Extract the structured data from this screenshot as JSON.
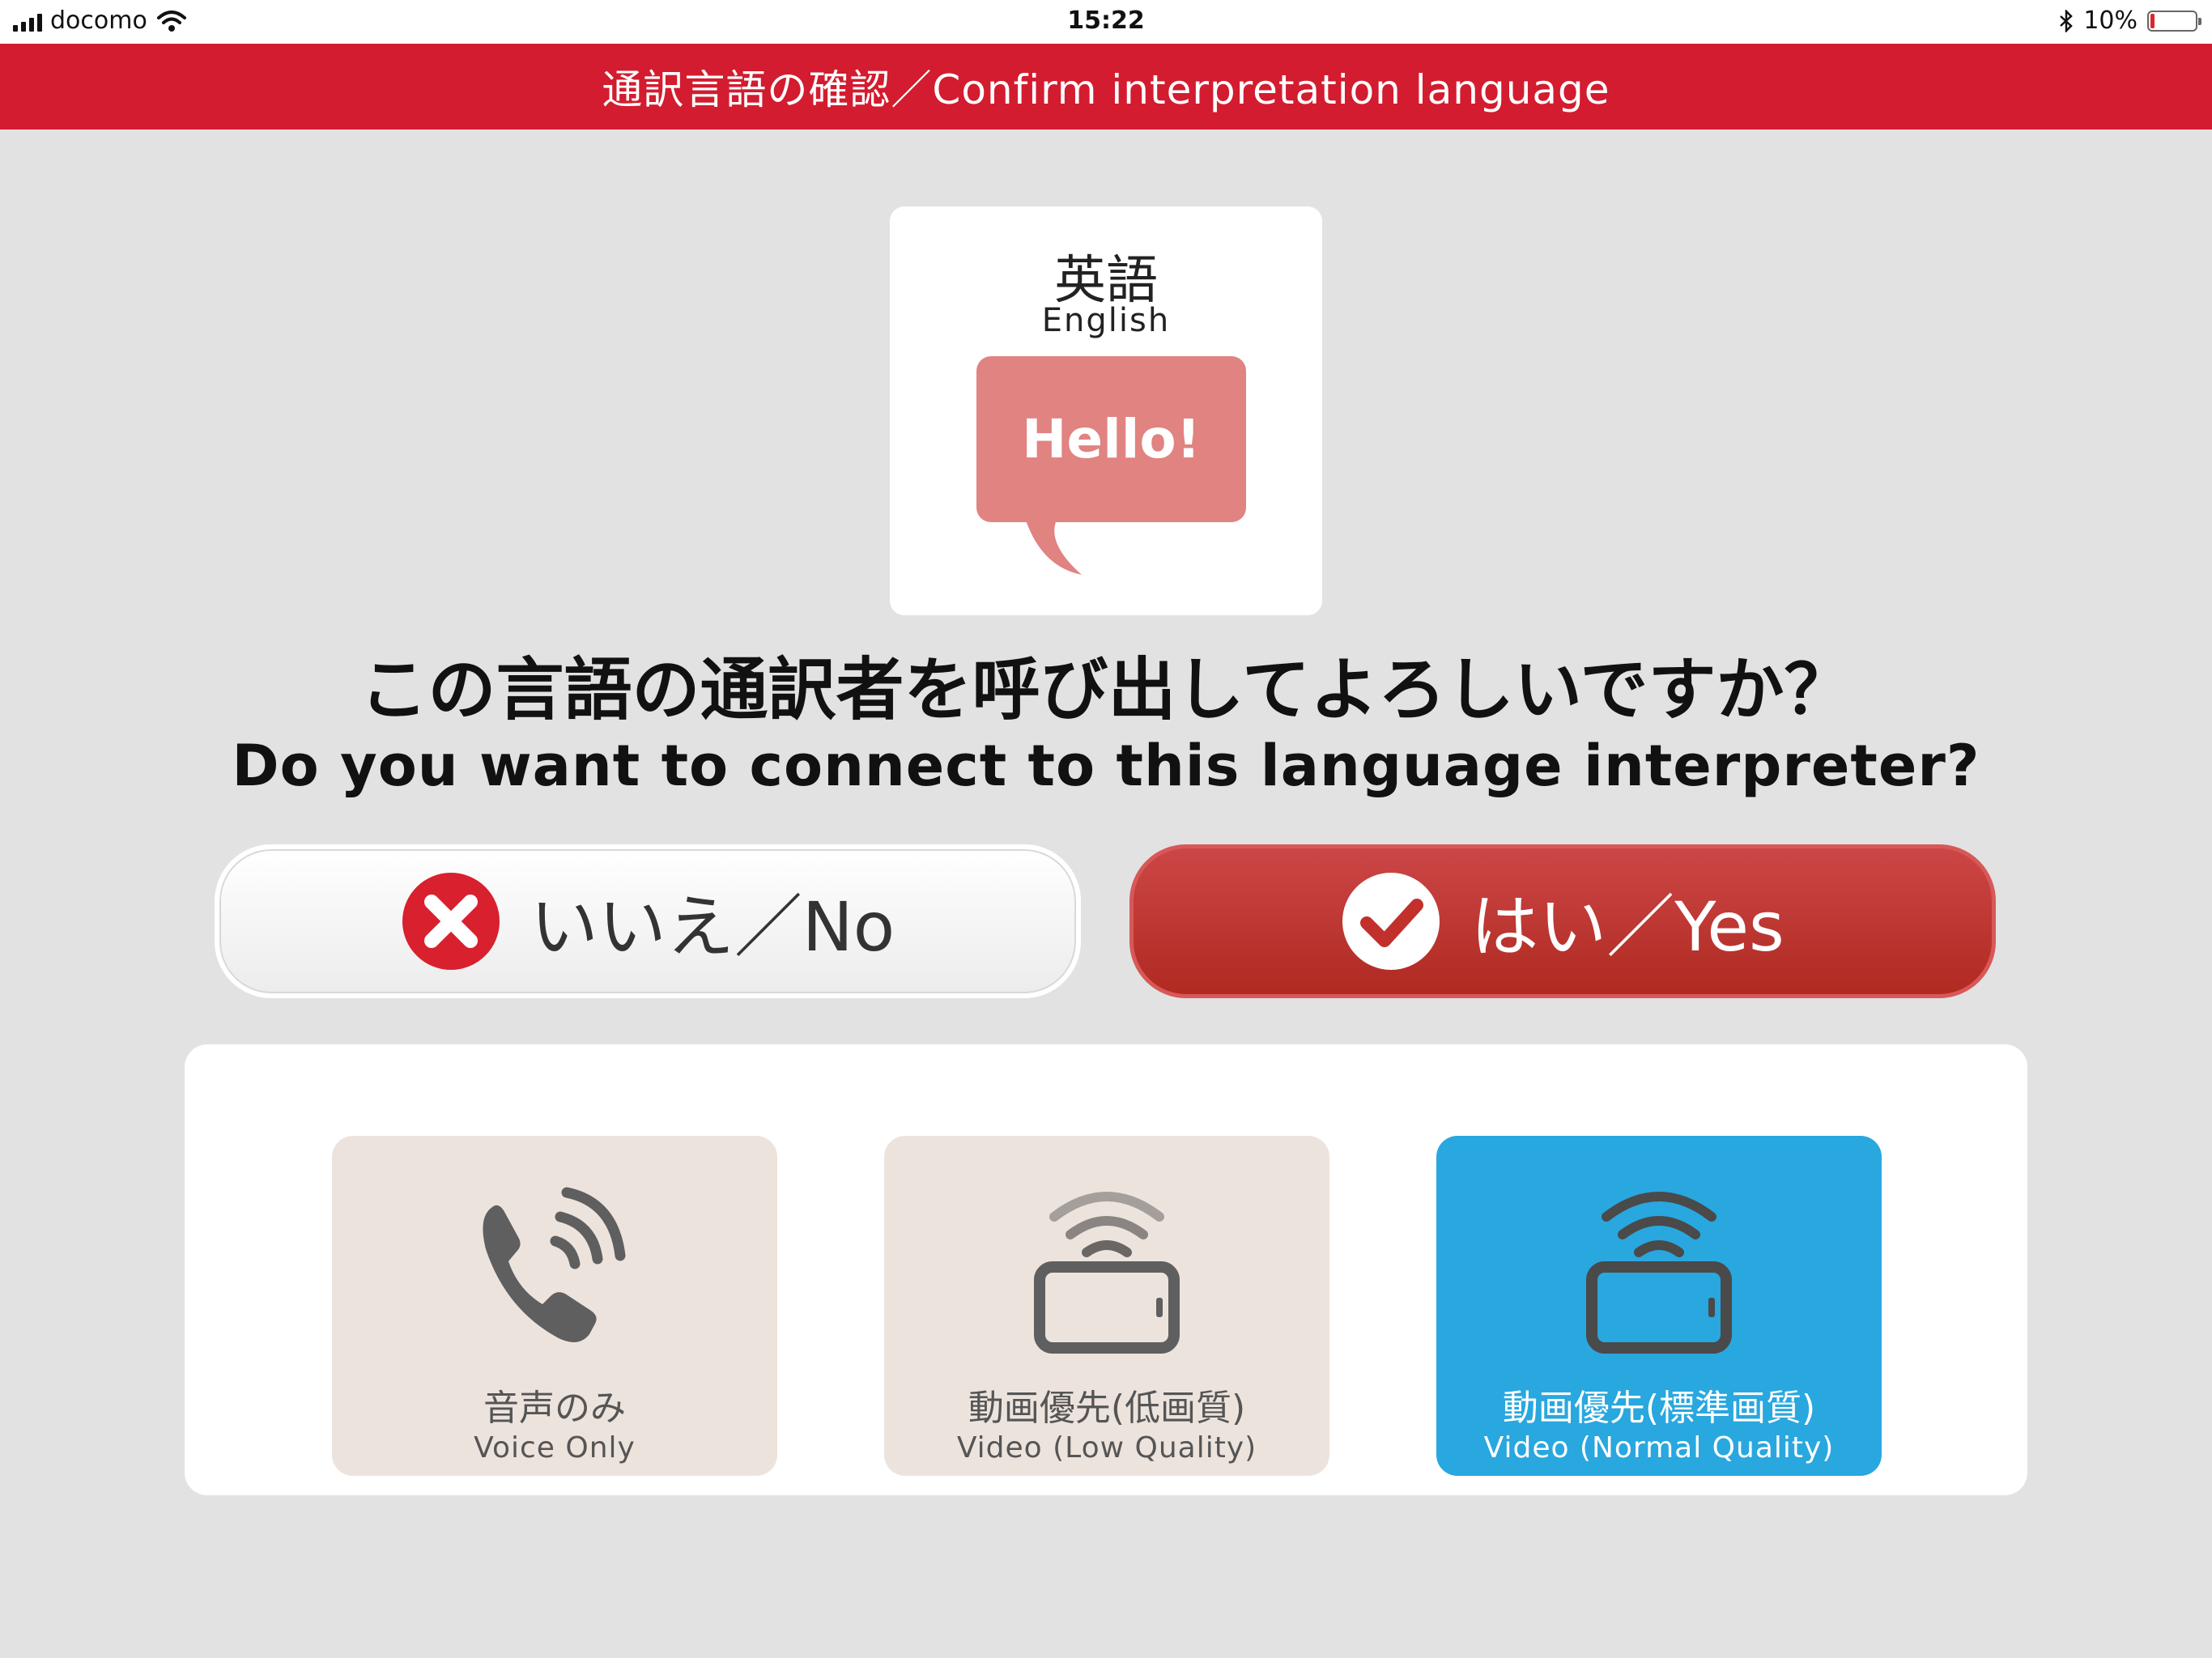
{
  "status": {
    "carrier": "docomo",
    "time": "15:22",
    "battery_text": "10%",
    "battery_level": 0.1
  },
  "header": {
    "title": "通訳言語の確認／Confirm interpretation language"
  },
  "language": {
    "name_jp": "英語",
    "name_en": "English",
    "bubble_text": "Hello!"
  },
  "question": {
    "jp": "この言語の通訳者を呼び出してよろしいですか？",
    "en": "Do you want to connect to this language interpreter?"
  },
  "buttons": {
    "no_label": "いいえ／No",
    "yes_label": "はい／Yes"
  },
  "modes": [
    {
      "jp": "音声のみ",
      "en": "Voice Only",
      "icon": "phone-icon",
      "selected": false
    },
    {
      "jp": "動画優先(低画質)",
      "en": "Video (Low Quality)",
      "icon": "video-low-icon",
      "selected": false
    },
    {
      "jp": "動画優先(標準画質)",
      "en": "Video (Normal Quality)",
      "icon": "video-normal-icon",
      "selected": true
    }
  ],
  "colors": {
    "header": "#d31c2f",
    "yes_button": "#b93530",
    "bubble": "#e08381",
    "selected_mode": "#29a7df",
    "mode_tile": "#ede3dd"
  }
}
